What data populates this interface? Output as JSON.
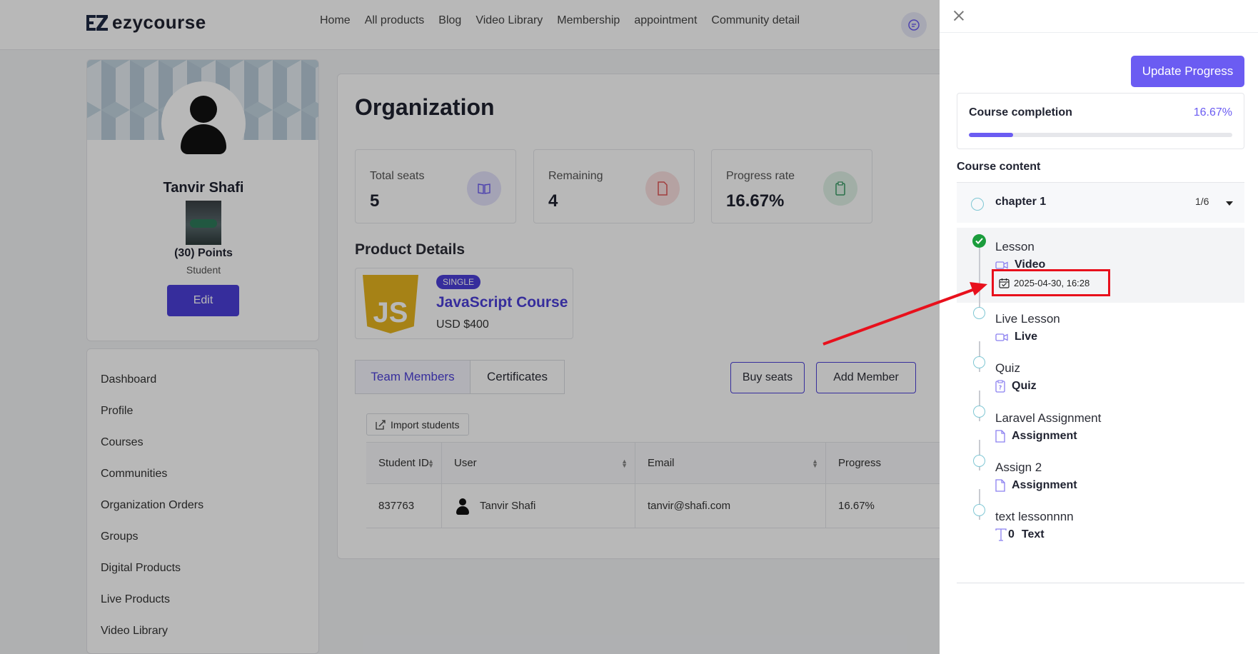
{
  "brand": {
    "name": "ezycourse",
    "mark": "EZ"
  },
  "nav": {
    "items": [
      "Home",
      "All products",
      "Blog",
      "Video Library",
      "Membership",
      "appointment",
      "Community detail"
    ]
  },
  "profile": {
    "name": "Tanvir Shafi",
    "points": "(30) Points",
    "role": "Student",
    "edit_label": "Edit"
  },
  "sidebar": {
    "items": [
      "Dashboard",
      "Profile",
      "Courses",
      "Communities",
      "Organization Orders",
      "Groups",
      "Digital Products",
      "Live Products",
      "Video Library"
    ]
  },
  "organization": {
    "title": "Organization",
    "stats": [
      {
        "label": "Total seats",
        "value": "5",
        "icon": "book-icon"
      },
      {
        "label": "Remaining",
        "value": "4",
        "icon": "document-icon"
      },
      {
        "label": "Progress rate",
        "value": "16.67%",
        "icon": "clipboard-icon"
      }
    ],
    "product_section_title": "Product Details",
    "product": {
      "badge": "SINGLE",
      "name": "JavaScript Course",
      "price": "USD $400",
      "logo_text": "JS"
    },
    "tabs": [
      "Team Members",
      "Certificates"
    ],
    "buttons": {
      "buy_seats": "Buy seats",
      "add_member": "Add Member",
      "import": "Import students"
    },
    "table": {
      "columns": [
        "Student ID",
        "User",
        "Email",
        "Progress"
      ],
      "rows": [
        {
          "student_id": "837763",
          "user": "Tanvir Shafi",
          "email": "tanvir@shafi.com",
          "progress": "16.67%"
        }
      ]
    }
  },
  "drawer": {
    "update_label": "Update Progress",
    "completion_label": "Course completion",
    "completion_value": "16.67%",
    "completion_fraction": 0.1667,
    "content_title": "Course content",
    "chapter": {
      "name": "chapter 1",
      "count": "1/6"
    },
    "lessons": [
      {
        "title": "Lesson",
        "type": "Video",
        "icon": "video-icon",
        "done": true,
        "date": "2025-04-30, 16:28"
      },
      {
        "title": "Live Lesson",
        "type": "Live",
        "icon": "video-icon",
        "done": false
      },
      {
        "title": "Quiz",
        "type": "Quiz",
        "icon": "quiz-icon",
        "done": false
      },
      {
        "title": "Laravel Assignment",
        "type": "Assignment",
        "icon": "file-icon",
        "done": false
      },
      {
        "title": "Assign 2",
        "type": "Assignment",
        "icon": "file-icon",
        "done": false
      },
      {
        "title": "text lessonnnn",
        "type": "Text",
        "prefix": "0",
        "icon": "text-icon",
        "done": false
      }
    ]
  },
  "colors": {
    "accent": "#6b5cf2",
    "primary": "#4b3fd8",
    "done": "#1a9c3c",
    "highlight": "#e8101c"
  }
}
